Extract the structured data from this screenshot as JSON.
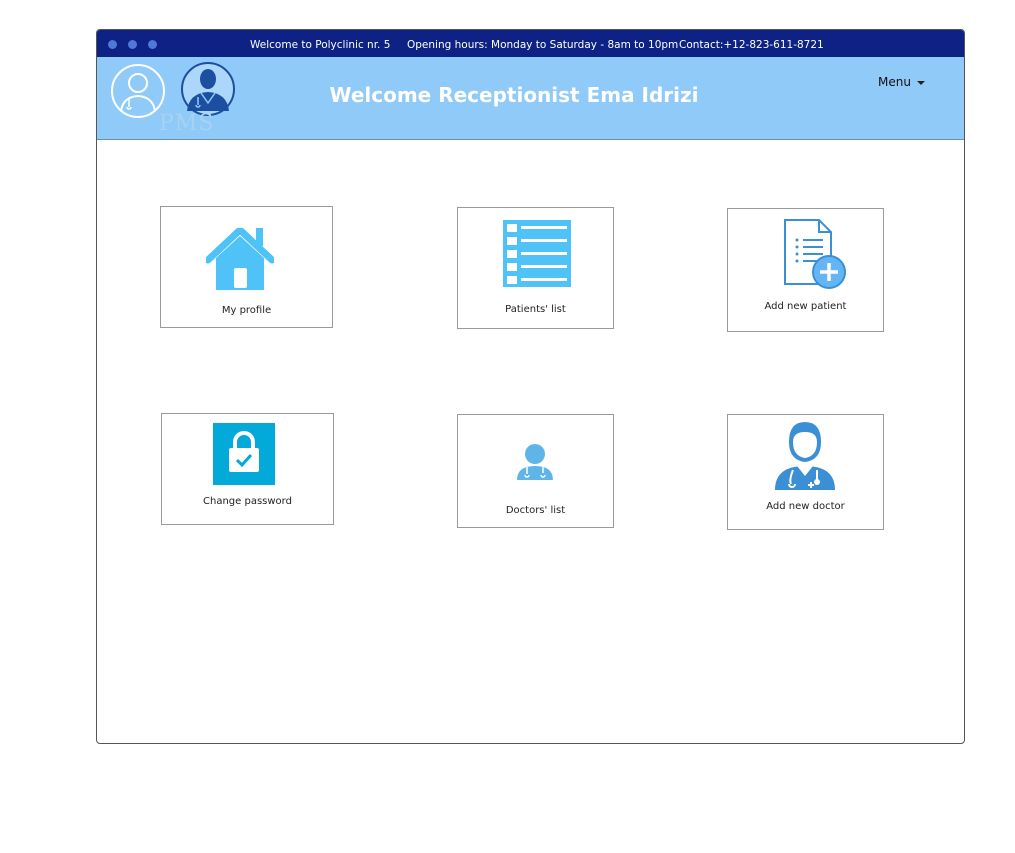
{
  "topbar": {
    "welcome": "Welcome to Polyclinic nr. 5",
    "hours": "Opening hours: Monday to Saturday - 8am to 10pm",
    "contact": "Contact:+12-823-611-8721"
  },
  "header": {
    "logo_text": "PMS",
    "title": "Welcome Receptionist Ema Idrizi",
    "menu_label": "Menu"
  },
  "tiles": [
    {
      "label": "My profile",
      "icon": "home-icon"
    },
    {
      "label": "Patients' list",
      "icon": "list-icon"
    },
    {
      "label": "Add new patient",
      "icon": "document-add-icon"
    },
    {
      "label": "Change password",
      "icon": "lock-icon"
    },
    {
      "label": "Doctors' list",
      "icon": "doctor-icon"
    },
    {
      "label": "Add new doctor",
      "icon": "add-doctor-icon"
    }
  ],
  "colors": {
    "topbar": "#0d2284",
    "header": "#90caf9",
    "icon_blue": "#4fc3f7",
    "lock_bg": "#03a9d8"
  }
}
